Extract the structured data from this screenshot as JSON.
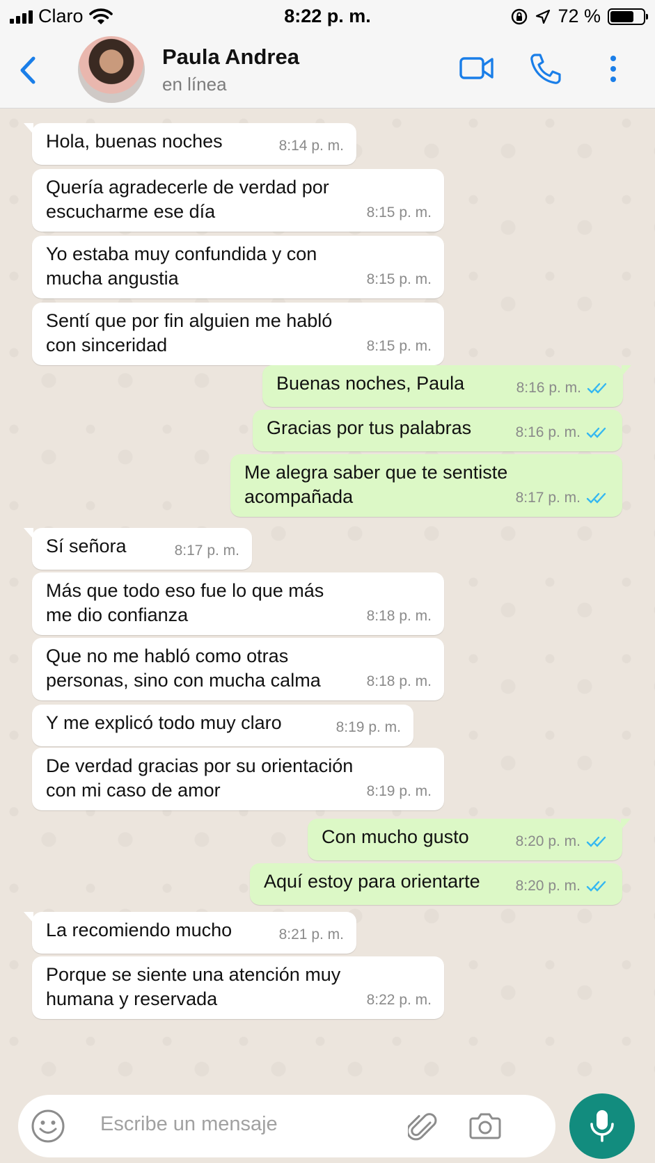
{
  "status_bar": {
    "carrier": "Claro",
    "time": "8:22 p. m.",
    "battery": "72 %",
    "battery_level": 0.72
  },
  "header": {
    "name": "Paula Andrea",
    "status": "en línea",
    "icons": [
      "back-chevron-icon",
      "video-call-icon",
      "phone-icon",
      "more-vertical-icon"
    ],
    "accent": "#1a7ee8"
  },
  "messages": [
    {
      "dir": "in",
      "text": "Hola, buenas noches",
      "time": "8:14 p. m."
    },
    {
      "dir": "in",
      "text": "Quería agradecerle de verdad por\nescucharme ese día",
      "time": "8:15 p. m."
    },
    {
      "dir": "in",
      "text": "Yo estaba muy confundida y con\nmucha angustia",
      "time": "8:15 p. m."
    },
    {
      "dir": "in",
      "text": "Sentí que por fin alguien me habló\ncon sinceridad",
      "time": "8:15 p. m."
    },
    {
      "dir": "out",
      "text": "Buenas noches, Paula",
      "time": "8:16 p. m."
    },
    {
      "dir": "out",
      "text": "Gracias por tus palabras",
      "time": "8:16 p. m."
    },
    {
      "dir": "out",
      "text": "Me alegra saber que te sentiste\nacompañada",
      "time": "8:17 p. m."
    },
    {
      "dir": "in",
      "text": "Sí señora",
      "time": "8:17 p. m."
    },
    {
      "dir": "in",
      "text": "Más que todo eso fue lo que más\nme dio confianza",
      "time": "8:18 p. m."
    },
    {
      "dir": "in",
      "text": "Que no me habló como otras\npersonas, sino con mucha calma",
      "time": "8:18 p. m."
    },
    {
      "dir": "in",
      "text": "Y me explicó todo muy claro",
      "time": "8:19 p. m."
    },
    {
      "dir": "in",
      "text": "De verdad gracias por su orientación\ncon mi caso de amor",
      "time": "8:19 p. m."
    },
    {
      "dir": "out",
      "text": "Con mucho gusto",
      "time": "8:20 p. m."
    },
    {
      "dir": "out",
      "text": "Aquí estoy para orientarte",
      "time": "8:20 p. m."
    },
    {
      "dir": "in",
      "text": "La recomiendo mucho",
      "time": "8:21 p. m."
    },
    {
      "dir": "in",
      "text": "Porque se siente una atención muy\nhumana y reservada",
      "time": "8:22 p. m."
    }
  ],
  "composer": {
    "placeholder": "Escribe un mensaje",
    "icons": [
      "emoji-icon",
      "attach-icon",
      "camera-icon",
      "mic-icon"
    ],
    "mic_color": "#128c7e"
  },
  "colors": {
    "incoming_bubble": "#ffffff",
    "outgoing_bubble": "#dcf8c6",
    "read_ticks": "#34b7f1",
    "chat_background": "#ece5dd"
  }
}
